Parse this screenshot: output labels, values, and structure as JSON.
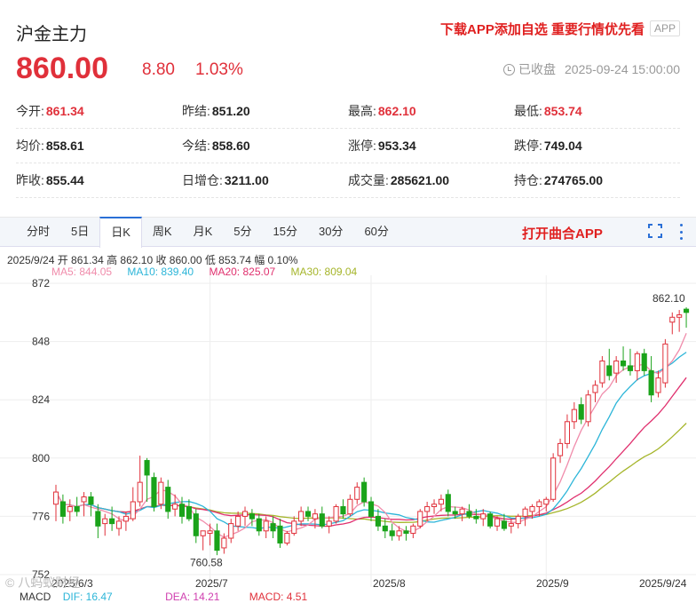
{
  "header": {
    "name": "沪金主力",
    "promo": "下载APP添加自选 重要行情优先看",
    "app_badge": "APP",
    "price": "860.00",
    "change": "8.80",
    "change_pct": "1.03%",
    "status": "已收盘",
    "datetime": "2025-09-24 15:00:00"
  },
  "stats": [
    [
      {
        "label": "今开:",
        "value": "861.34",
        "color": "red"
      },
      {
        "label": "昨结:",
        "value": "851.20",
        "color": "black"
      },
      {
        "label": "最高:",
        "value": "862.10",
        "color": "red"
      },
      {
        "label": "最低:",
        "value": "853.74",
        "color": "red"
      }
    ],
    [
      {
        "label": "均价:",
        "value": "858.61",
        "color": "black"
      },
      {
        "label": "今结:",
        "value": "858.60",
        "color": "black"
      },
      {
        "label": "涨停:",
        "value": "953.34",
        "color": "black"
      },
      {
        "label": "跌停:",
        "value": "749.04",
        "color": "black"
      }
    ],
    [
      {
        "label": "昨收:",
        "value": "855.44",
        "color": "black"
      },
      {
        "label": "日增仓:",
        "value": "3211.00",
        "color": "black"
      },
      {
        "label": "成交量:",
        "value": "285621.00",
        "color": "black"
      },
      {
        "label": "持仓:",
        "value": "274765.00",
        "color": "black"
      }
    ]
  ],
  "tabs": [
    "分时",
    "5日",
    "日K",
    "周K",
    "月K",
    "5分",
    "15分",
    "30分",
    "60分"
  ],
  "active_tab": "日K",
  "open_app": "打开曲合APP",
  "info_line": "2025/9/24  开 861.34  高 862.10  收 860.00  低 853.74  幅 0.10%",
  "ma": {
    "ma5": "MA5: 844.05",
    "ma10": "MA10: 839.40",
    "ma20": "MA20: 825.07",
    "ma30": "MA30: 809.04"
  },
  "macd": {
    "label": "MACD",
    "dif": "DIF: 16.47",
    "dea": "DEA: 14.21",
    "macd": "MACD: 4.51"
  },
  "watermark": "© 八蚂蚁财经",
  "colors": {
    "up": "#e0303a",
    "down": "#1aa31a",
    "ma5": "#f08cab",
    "ma10": "#2bb5d8",
    "ma20": "#e0306e",
    "ma30": "#a5b52a",
    "accent": "#2a6fd6"
  },
  "chart_data": {
    "type": "candlestick",
    "y_ticks": [
      "872",
      "848",
      "824",
      "800",
      "776",
      "752"
    ],
    "ylim": [
      752,
      872
    ],
    "x_ticks": [
      "2025/6/3",
      "2025/7",
      "2025/8",
      "2025/9",
      "2025/9/24"
    ],
    "annotations": {
      "high": "862.10",
      "low": "760.58"
    },
    "candles": [
      {
        "o": 781,
        "h": 789,
        "l": 774,
        "c": 786
      },
      {
        "o": 782,
        "h": 785,
        "l": 773,
        "c": 776
      },
      {
        "o": 778,
        "h": 783,
        "l": 774,
        "c": 780
      },
      {
        "o": 780,
        "h": 784,
        "l": 776,
        "c": 778
      },
      {
        "o": 782,
        "h": 786,
        "l": 776,
        "c": 784
      },
      {
        "o": 784,
        "h": 786,
        "l": 776,
        "c": 781
      },
      {
        "o": 778,
        "h": 781,
        "l": 767,
        "c": 772
      },
      {
        "o": 773,
        "h": 777,
        "l": 768,
        "c": 775
      },
      {
        "o": 775,
        "h": 780,
        "l": 770,
        "c": 773
      },
      {
        "o": 771,
        "h": 776,
        "l": 768,
        "c": 774
      },
      {
        "o": 774,
        "h": 778,
        "l": 770,
        "c": 776
      },
      {
        "o": 775,
        "h": 788,
        "l": 774,
        "c": 782
      },
      {
        "o": 782,
        "h": 801,
        "l": 780,
        "c": 790
      },
      {
        "o": 799,
        "h": 800,
        "l": 782,
        "c": 793
      },
      {
        "o": 792,
        "h": 794,
        "l": 778,
        "c": 780
      },
      {
        "o": 781,
        "h": 792,
        "l": 779,
        "c": 790
      },
      {
        "o": 788,
        "h": 791,
        "l": 775,
        "c": 778
      },
      {
        "o": 779,
        "h": 785,
        "l": 776,
        "c": 781
      },
      {
        "o": 781,
        "h": 784,
        "l": 773,
        "c": 776
      },
      {
        "o": 780,
        "h": 783,
        "l": 774,
        "c": 775
      },
      {
        "o": 777,
        "h": 779,
        "l": 765,
        "c": 768
      },
      {
        "o": 768,
        "h": 770,
        "l": 762,
        "c": 770
      },
      {
        "o": 769,
        "h": 773,
        "l": 764,
        "c": 770
      },
      {
        "o": 770,
        "h": 773,
        "l": 760,
        "c": 762
      },
      {
        "o": 763,
        "h": 769,
        "l": 760.58,
        "c": 767
      },
      {
        "o": 767,
        "h": 775,
        "l": 765,
        "c": 773
      },
      {
        "o": 772,
        "h": 778,
        "l": 770,
        "c": 776
      },
      {
        "o": 776,
        "h": 780,
        "l": 772,
        "c": 778
      },
      {
        "o": 777,
        "h": 779,
        "l": 772,
        "c": 775
      },
      {
        "o": 775,
        "h": 777,
        "l": 768,
        "c": 770
      },
      {
        "o": 770,
        "h": 776,
        "l": 767,
        "c": 774
      },
      {
        "o": 773,
        "h": 776,
        "l": 767,
        "c": 770
      },
      {
        "o": 772,
        "h": 775,
        "l": 763,
        "c": 765
      },
      {
        "o": 765,
        "h": 770,
        "l": 764,
        "c": 769
      },
      {
        "o": 769,
        "h": 776,
        "l": 768,
        "c": 774
      },
      {
        "o": 774,
        "h": 780,
        "l": 772,
        "c": 778
      },
      {
        "o": 778,
        "h": 780,
        "l": 774,
        "c": 776
      },
      {
        "o": 775,
        "h": 779,
        "l": 771,
        "c": 777
      },
      {
        "o": 777,
        "h": 780,
        "l": 771,
        "c": 772
      },
      {
        "o": 772,
        "h": 776,
        "l": 769,
        "c": 774
      },
      {
        "o": 774,
        "h": 781,
        "l": 773,
        "c": 780
      },
      {
        "o": 780,
        "h": 783,
        "l": 775,
        "c": 777
      },
      {
        "o": 777,
        "h": 785,
        "l": 776,
        "c": 783
      },
      {
        "o": 783,
        "h": 790,
        "l": 781,
        "c": 788
      },
      {
        "o": 790,
        "h": 792,
        "l": 780,
        "c": 782
      },
      {
        "o": 782,
        "h": 784,
        "l": 774,
        "c": 776
      },
      {
        "o": 776,
        "h": 779,
        "l": 770,
        "c": 772
      },
      {
        "o": 772,
        "h": 775,
        "l": 767,
        "c": 770
      },
      {
        "o": 770,
        "h": 773,
        "l": 766,
        "c": 768
      },
      {
        "o": 768,
        "h": 772,
        "l": 766,
        "c": 770
      },
      {
        "o": 770,
        "h": 772,
        "l": 766,
        "c": 769
      },
      {
        "o": 769,
        "h": 773,
        "l": 767,
        "c": 772
      },
      {
        "o": 772,
        "h": 779,
        "l": 771,
        "c": 778
      },
      {
        "o": 778,
        "h": 782,
        "l": 774,
        "c": 780
      },
      {
        "o": 780,
        "h": 783,
        "l": 777,
        "c": 781
      },
      {
        "o": 781,
        "h": 785,
        "l": 778,
        "c": 783
      },
      {
        "o": 785,
        "h": 787,
        "l": 776,
        "c": 778
      },
      {
        "o": 778,
        "h": 780,
        "l": 775,
        "c": 777
      },
      {
        "o": 777,
        "h": 780,
        "l": 774,
        "c": 779
      },
      {
        "o": 778,
        "h": 781,
        "l": 775,
        "c": 776
      },
      {
        "o": 776,
        "h": 779,
        "l": 773,
        "c": 775
      },
      {
        "o": 775,
        "h": 779,
        "l": 772,
        "c": 777
      },
      {
        "o": 777,
        "h": 778,
        "l": 771,
        "c": 772
      },
      {
        "o": 772,
        "h": 776,
        "l": 770,
        "c": 775
      },
      {
        "o": 774,
        "h": 777,
        "l": 770,
        "c": 771
      },
      {
        "o": 772,
        "h": 775,
        "l": 769,
        "c": 773
      },
      {
        "o": 773,
        "h": 777,
        "l": 771,
        "c": 776
      },
      {
        "o": 776,
        "h": 780,
        "l": 772,
        "c": 779
      },
      {
        "o": 778,
        "h": 781,
        "l": 775,
        "c": 780
      },
      {
        "o": 780,
        "h": 783,
        "l": 776,
        "c": 782
      },
      {
        "o": 781,
        "h": 784,
        "l": 778,
        "c": 783
      },
      {
        "o": 783,
        "h": 802,
        "l": 782,
        "c": 800
      },
      {
        "o": 801,
        "h": 808,
        "l": 798,
        "c": 806
      },
      {
        "o": 806,
        "h": 818,
        "l": 804,
        "c": 815
      },
      {
        "o": 815,
        "h": 823,
        "l": 812,
        "c": 820
      },
      {
        "o": 822,
        "h": 825,
        "l": 814,
        "c": 816
      },
      {
        "o": 815,
        "h": 828,
        "l": 813,
        "c": 826
      },
      {
        "o": 827,
        "h": 832,
        "l": 823,
        "c": 830
      },
      {
        "o": 831,
        "h": 842,
        "l": 829,
        "c": 840
      },
      {
        "o": 838,
        "h": 845,
        "l": 832,
        "c": 834
      },
      {
        "o": 835,
        "h": 842,
        "l": 831,
        "c": 840
      },
      {
        "o": 840,
        "h": 846,
        "l": 836,
        "c": 838
      },
      {
        "o": 838,
        "h": 845,
        "l": 834,
        "c": 836
      },
      {
        "o": 836,
        "h": 844,
        "l": 832,
        "c": 843
      },
      {
        "o": 843,
        "h": 845,
        "l": 834,
        "c": 836
      },
      {
        "o": 836,
        "h": 842,
        "l": 823,
        "c": 826
      },
      {
        "o": 827,
        "h": 836,
        "l": 825,
        "c": 833
      },
      {
        "o": 831,
        "h": 849,
        "l": 829,
        "c": 847
      },
      {
        "o": 856,
        "h": 860,
        "l": 851,
        "c": 858
      },
      {
        "o": 858,
        "h": 861,
        "l": 852,
        "c": 859
      },
      {
        "o": 861.34,
        "h": 862.1,
        "l": 853.74,
        "c": 860
      }
    ]
  }
}
